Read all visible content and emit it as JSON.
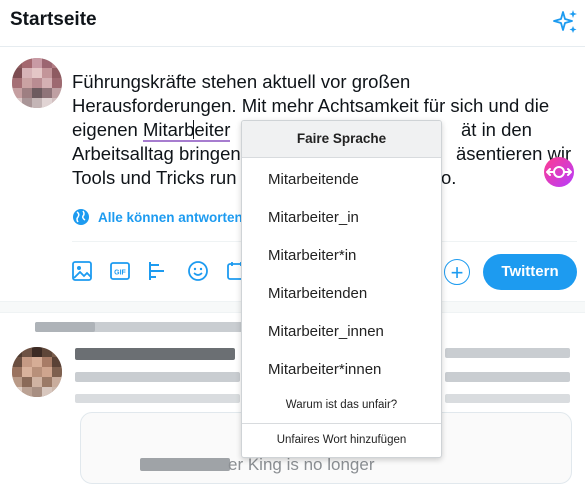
{
  "header": {
    "title": "Startseite"
  },
  "composer": {
    "text_lines": [
      "Führungskräfte stehen aktuell vor großen",
      "Herausforderungen. Mit mehr Achtsamkeit für sich und die"
    ],
    "line3_before": "eigenen ",
    "line3_flagged_a": "Mitarb",
    "line3_flagged_b": "eiter",
    "line3_tail": "ät in den",
    "line4_head": "Arbeitsalltag bringen",
    "line4_tail": "äsentieren wir",
    "line5_head": "Tools und Tricks run",
    "line5_tail": "o.",
    "reply_setting": "Alle können antworten",
    "tweet_button": "Twittern",
    "add_button": "+"
  },
  "popup": {
    "title": "Faire Sprache",
    "suggestions": [
      "Mitarbeitende",
      "Mitarbeiter_in",
      "Mitarbeiter*in",
      "Mitarbeitenden",
      "Mitarbeiter_innen",
      "Mitarbeiter*innen"
    ],
    "why_link": "Warum ist das unfair?",
    "add_word": "Unfaires Wort hinzufügen"
  },
  "feed": {
    "partial_text": "er King is no longer"
  },
  "colors": {
    "accent": "#1d9bf0",
    "flag_underline": "#a67ccf"
  }
}
